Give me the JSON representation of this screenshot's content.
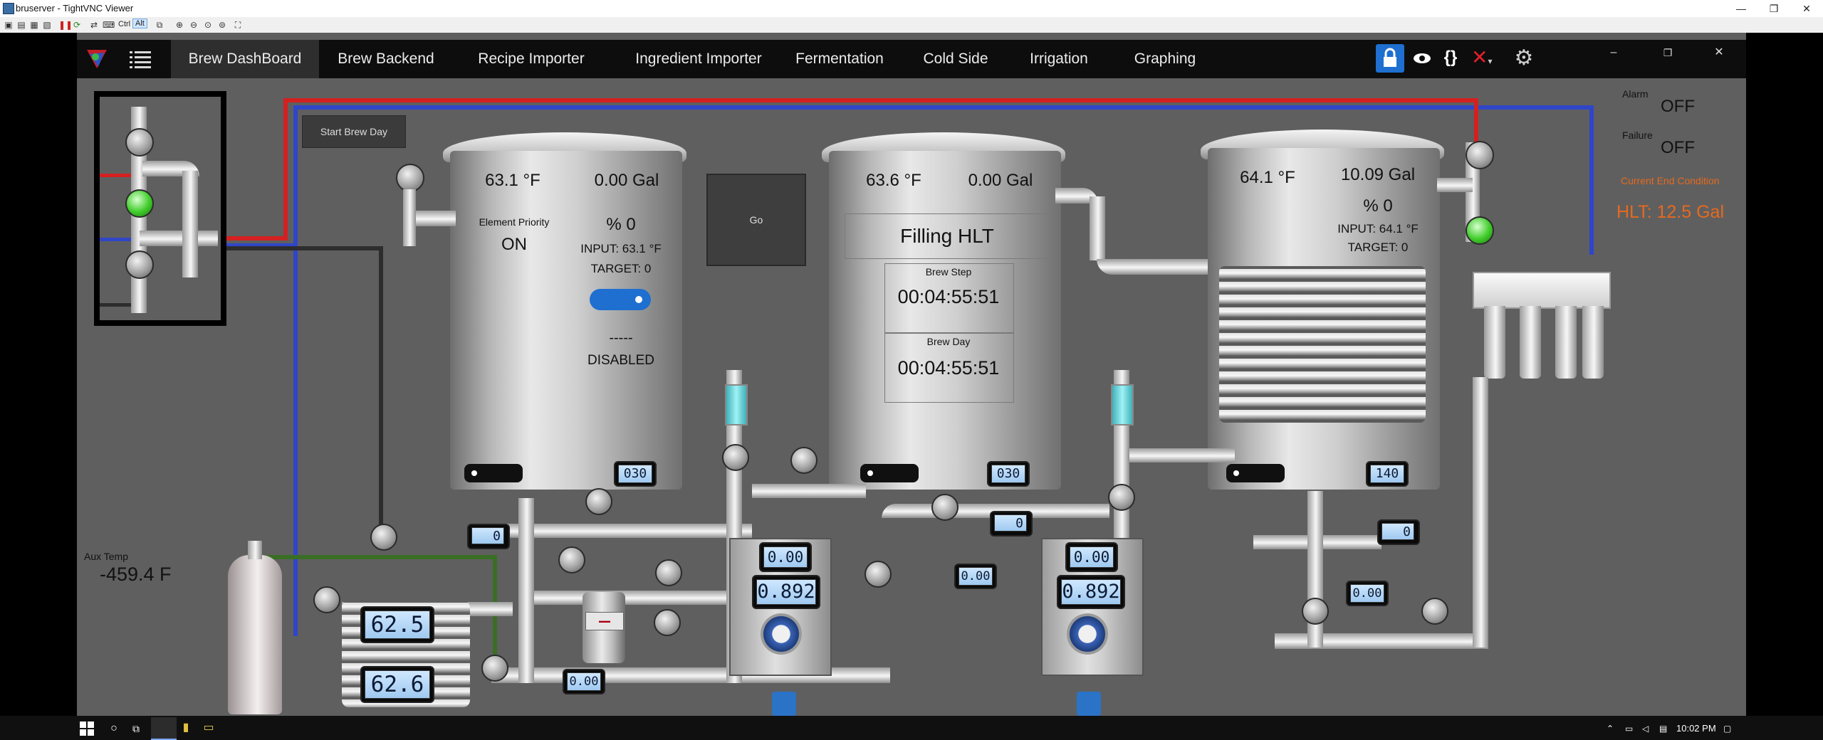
{
  "window": {
    "title": "bruserver - TightVNC Viewer"
  },
  "toolbar": {
    "ctrl_label": "Ctrl",
    "alt_label": "Alt"
  },
  "nav": {
    "items": [
      "Brew DashBoard",
      "Brew Backend",
      "Recipe Importer",
      "Ingredient Importer",
      "Fermentation",
      "Cold Side",
      "Irrigation",
      "Graphing"
    ],
    "active": "Brew DashBoard"
  },
  "controls": {
    "start_brew_day": "Start Brew Day",
    "go": "Go"
  },
  "tank1": {
    "temp": "63.1 °F",
    "volume": "0.00 Gal",
    "element_priority_label": "Element Priority",
    "element_priority": "ON",
    "percent": "% 0",
    "input": "INPUT: 63.1 °F",
    "target": "TARGET: 0",
    "dashes": "-----",
    "status": "DISABLED",
    "gauge": "030"
  },
  "tank2": {
    "temp": "63.6 °F",
    "volume": "0.00 Gal",
    "state": "Filling HLT",
    "brew_step_label": "Brew Step",
    "brew_step_time": "00:04:55:51",
    "brew_day_label": "Brew Day",
    "brew_day_time": "00:04:55:51",
    "gauge": "030"
  },
  "tank3": {
    "temp": "64.1 °F",
    "volume": "10.09 Gal",
    "percent": "% 0",
    "input": "INPUT: 64.1 °F",
    "target": "TARGET: 0",
    "gauge": "140"
  },
  "status": {
    "alarm_label": "Alarm",
    "alarm_value": "OFF",
    "failure_label": "Failure",
    "failure_value": "OFF",
    "condition_label": "Current End Condition",
    "condition_value": "HLT: 12.5 Gal"
  },
  "aux": {
    "label": "Aux Temp",
    "value": "-459.4 F"
  },
  "readouts": {
    "flow_left": "0",
    "flow_mid": "0",
    "flow_right": "0",
    "pump1_top": "0.00",
    "pump1_bottom": "0.892",
    "pump2_top": "0.00",
    "pump2_bottom": "0.892",
    "chiller1": "62.5",
    "chiller2": "62.6",
    "small_bottom": "0.00",
    "small_mid": "0.00",
    "small_right": "0.00"
  },
  "taskbar": {
    "time": "10:02 PM"
  },
  "colors": {
    "hot": "#d42020",
    "cold": "#2f46c8",
    "accent": "#e66a1f",
    "nav_bg": "#0d0d0d"
  }
}
